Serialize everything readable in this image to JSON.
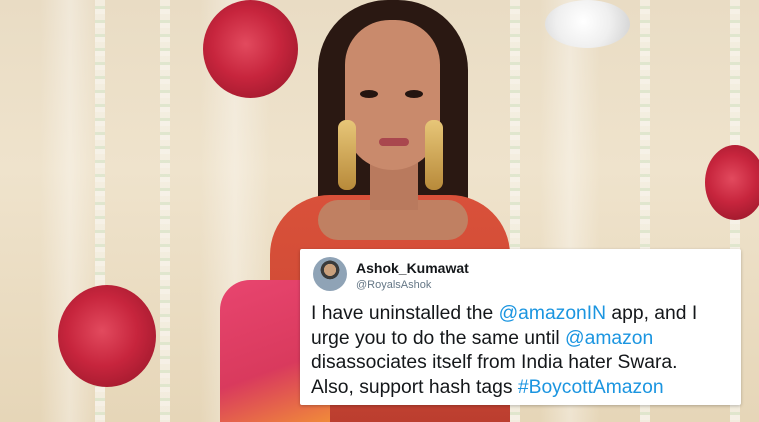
{
  "tweet": {
    "name": "Ashok_Kumawat",
    "handle": "@RoyalsAshok",
    "line1_pre": "I have uninstalled the ",
    "line1_link": "@amazonIN",
    "line1_post": " app, and I",
    "line2_pre": "urge you to do the same until ",
    "line2_link": "@amazon",
    "line3": "disassociates itself from India hater Swara.",
    "line4_pre": "Also, support hash tags ",
    "line4_link": "#BoycottAmazon",
    "link_color": "#1b95e0"
  }
}
